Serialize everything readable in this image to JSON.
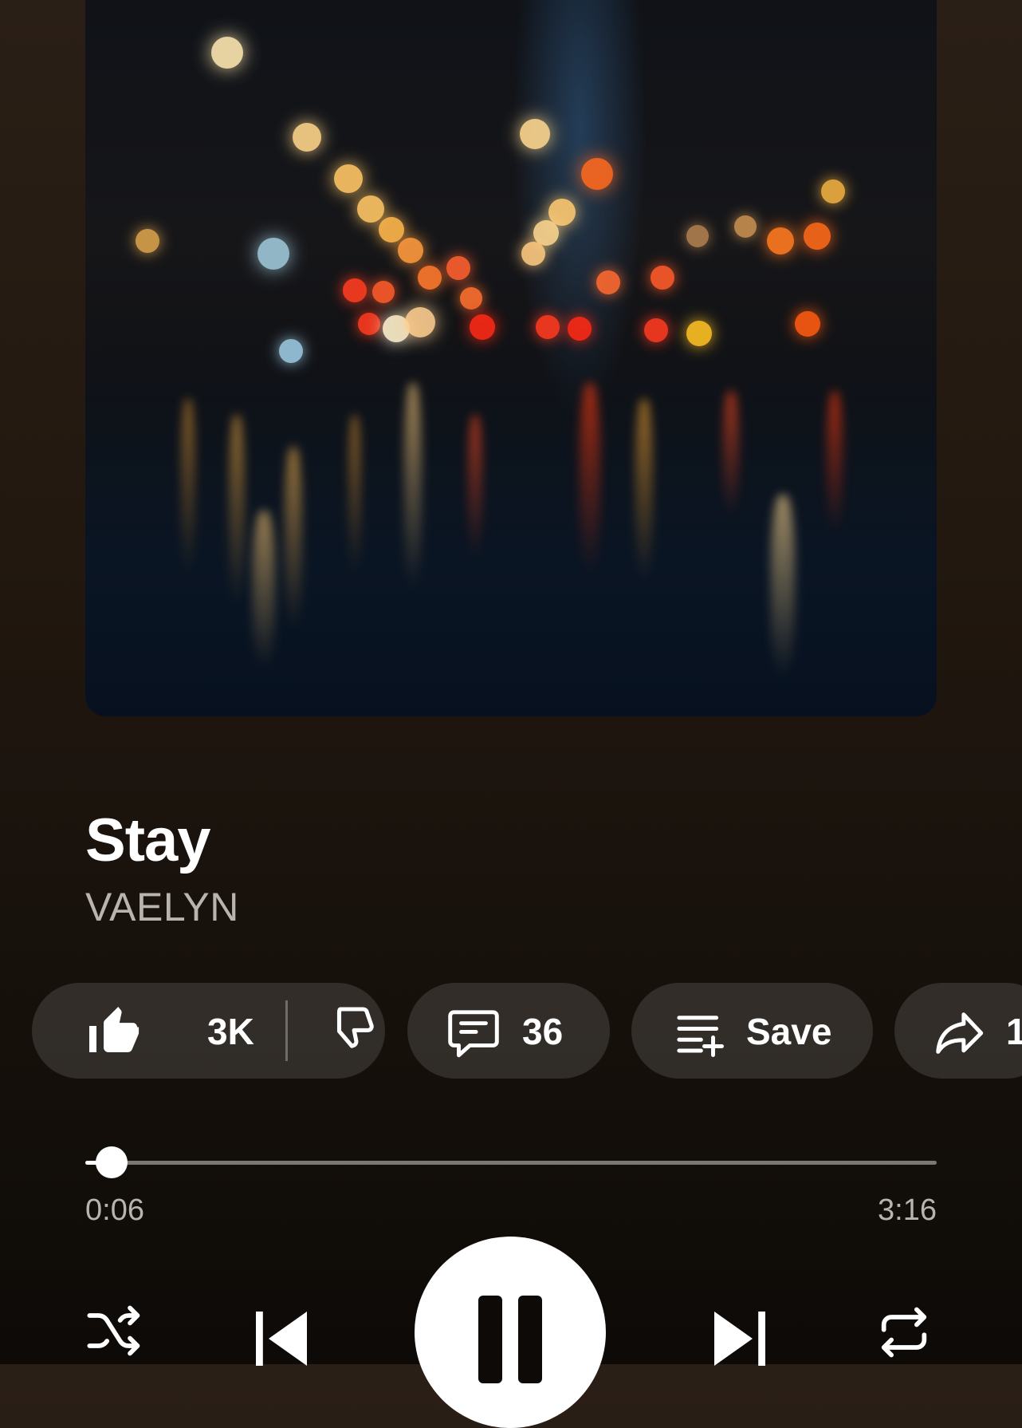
{
  "album_art": {
    "alt": ""
  },
  "track": {
    "title": "Stay",
    "artist": "VAELYN"
  },
  "actions": {
    "like_count": "3K",
    "comment_count": "36",
    "save_label": "Save",
    "share_label": "1"
  },
  "progress": {
    "current_time": "0:06",
    "total_time": "3:16",
    "fraction": 0.031
  },
  "controls": {
    "shuffle_icon": "shuffle-icon",
    "previous_icon": "skip-previous-icon",
    "play_state_icon": "pause-icon",
    "next_icon": "skip-next-icon",
    "repeat_icon": "repeat-icon"
  },
  "colors": {
    "background": "#22180f",
    "chip": "#3a332d",
    "accent": "#ffffff",
    "muted_text": "#b9b4ae"
  }
}
